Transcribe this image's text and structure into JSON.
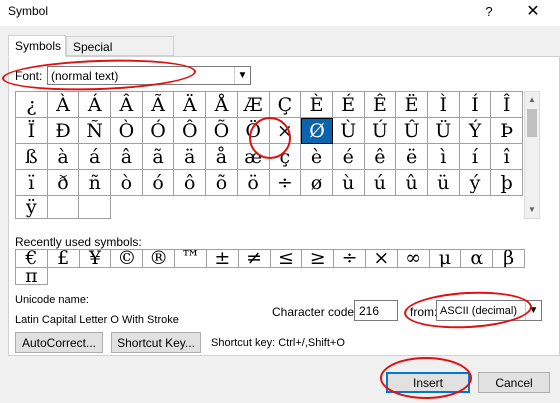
{
  "window": {
    "title": "Symbol",
    "help": "?",
    "close": "✕"
  },
  "tabs": [
    {
      "label": "Symbols"
    },
    {
      "label": "Special Characters"
    }
  ],
  "font": {
    "label": "Font:",
    "value": "(normal text)"
  },
  "symbols": [
    "¿",
    "À",
    "Á",
    "Â",
    "Ã",
    "Ä",
    "Å",
    "Æ",
    "Ç",
    "È",
    "É",
    "Ê",
    "Ë",
    "Ì",
    "Í",
    "Î",
    "Ï",
    "Ð",
    "Ñ",
    "Ò",
    "Ó",
    "Ô",
    "Õ",
    "Ö",
    "×",
    "Ø",
    "Ù",
    "Ú",
    "Û",
    "Ü",
    "Ý",
    "Þ",
    "ß",
    "à",
    "á",
    "â",
    "ã",
    "ä",
    "å",
    "æ",
    "ç",
    "è",
    "é",
    "ê",
    "ë",
    "ì",
    "í",
    "î",
    "ï",
    "ð",
    "ñ",
    "ò",
    "ó",
    "ô",
    "õ",
    "ö",
    "÷",
    "ø",
    "ù",
    "ú",
    "û",
    "ü",
    "ý",
    "þ",
    "ÿ",
    "",
    ""
  ],
  "selected_symbol": "Ø",
  "recent": {
    "label": "Recently used symbols:",
    "symbols": [
      "€",
      "£",
      "¥",
      "©",
      "®",
      "™",
      "±",
      "≠",
      "≤",
      "≥",
      "÷",
      "×",
      "∞",
      "µ",
      "α",
      "β",
      "π"
    ]
  },
  "unicode": {
    "label": "Unicode name:",
    "name": "Latin Capital Letter O With Stroke"
  },
  "char_code": {
    "label": "Character code:",
    "value": "216"
  },
  "from": {
    "label": "from:",
    "value": "ASCII (decimal)"
  },
  "buttons": {
    "autocorrect": "AutoCorrect...",
    "shortcut": "Shortcut Key...",
    "insert": "Insert",
    "cancel": "Cancel"
  },
  "shortcut_text": "Shortcut key: Ctrl+/,Shift+O",
  "colors": {
    "selection": "#0a64ad",
    "annotation": "#e01010",
    "default_button_border": "#0078d7"
  }
}
